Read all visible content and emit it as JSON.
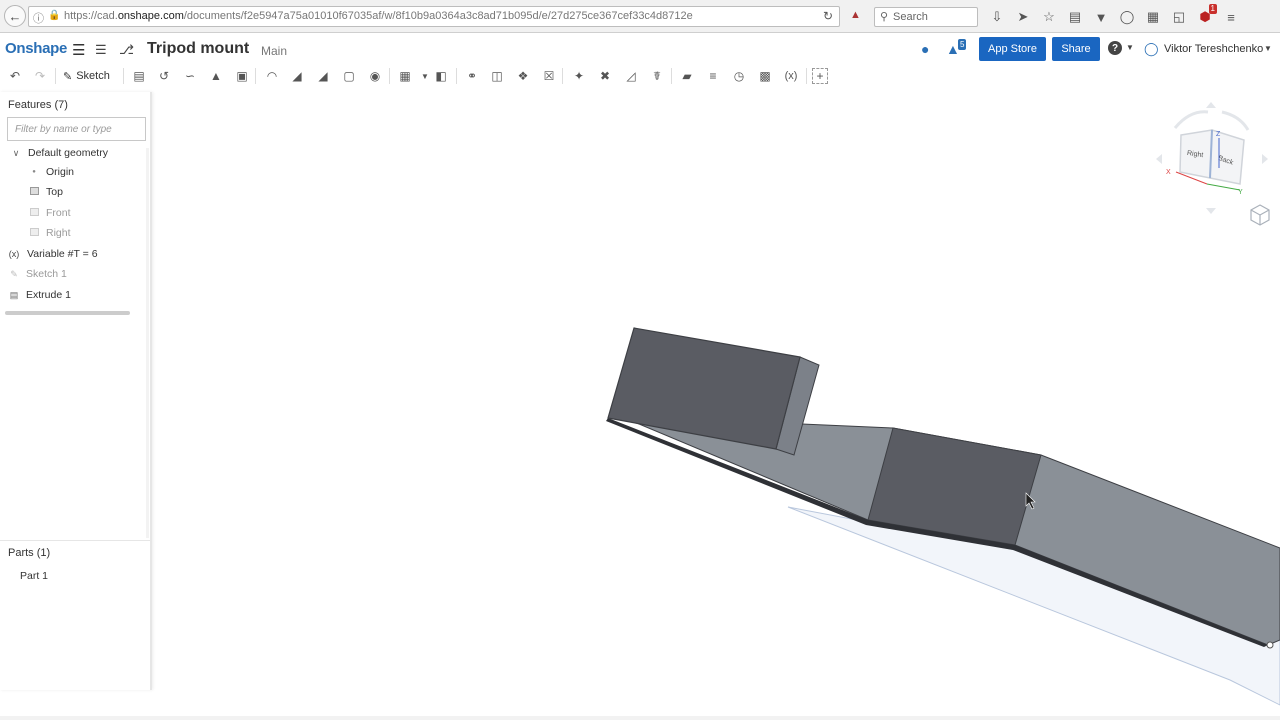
{
  "browser": {
    "url_prefix": "https://cad.",
    "url_domain": "onshape.com",
    "url_path": "/documents/f2e5947a75a01010f67035af/w/8f10b9a0364a3c8ad71b095d/e/27d275ce367cef33c4d8712e",
    "search_placeholder": "Search",
    "addon_badge": "1"
  },
  "header": {
    "logo": "Onshape",
    "document_title": "Tripod mount",
    "workspace": "Main",
    "notification_count": "5",
    "app_store_label": "App Store",
    "share_label": "Share",
    "help_label": "?",
    "user_name": "Viktor Tereshchenko"
  },
  "toolbar": {
    "sketch_label": "Sketch",
    "variable_label": "(x)"
  },
  "features": {
    "heading": "Features (7)",
    "filter_placeholder": "Filter by name or type",
    "default_geometry": "Default geometry",
    "origin": "Origin",
    "plane_top": "Top",
    "plane_front": "Front",
    "plane_right": "Right",
    "variable_icon": "(x)",
    "variable": "Variable #T = 6",
    "sketch": "Sketch 1",
    "extrude": "Extrude 1"
  },
  "parts": {
    "heading": "Parts (1)",
    "items": [
      "Part 1"
    ]
  },
  "view_cube": {
    "face_right": "Right",
    "face_back": "Back",
    "axis_x": "X",
    "axis_y": "Y",
    "axis_z": "Z"
  },
  "colors": {
    "brand": "#2a6fb5",
    "button": "#1a66c1",
    "face_dark": "#5a5c63",
    "face_light": "#8a9097"
  }
}
